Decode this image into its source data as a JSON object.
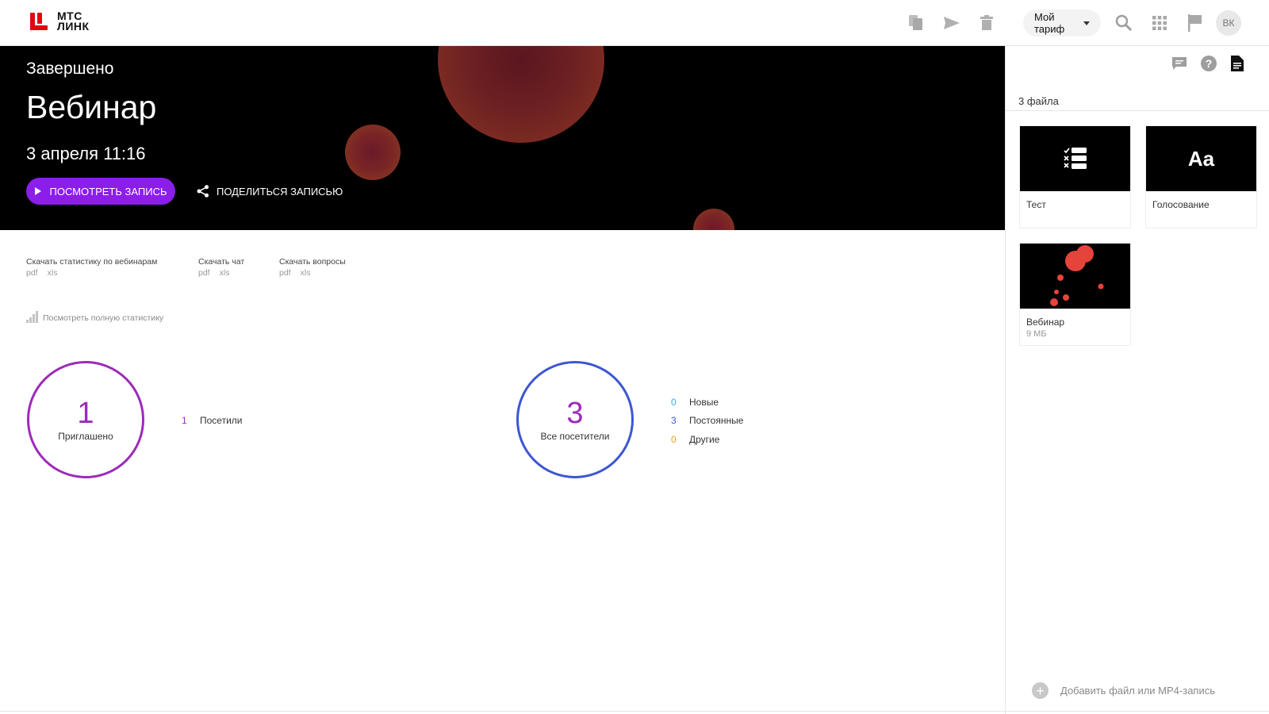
{
  "header": {
    "logo_line1": "МТС",
    "logo_line2": "ЛИНК",
    "tariff_label": "Мой тариф",
    "avatar_initials": "ВК"
  },
  "hero": {
    "status": "Завершено",
    "title": "Вебинар",
    "date": "3 апреля 11:16",
    "watch_button": "ПОСМОТРЕТЬ ЗАПИСЬ",
    "share_button": "ПОДЕЛИТЬСЯ ЗАПИСЬЮ"
  },
  "downloads": [
    {
      "label": "Скачать статистику по вебинарам",
      "formats": [
        "pdf",
        "xls"
      ]
    },
    {
      "label": "Скачать чат",
      "formats": [
        "pdf",
        "xls"
      ]
    },
    {
      "label": "Скачать вопросы",
      "formats": [
        "pdf",
        "xls"
      ]
    }
  ],
  "full_stats_link": "Посмотреть полную статистику",
  "invited": {
    "count": "1",
    "label": "Приглашено",
    "rows": [
      {
        "value": "1",
        "label": "Посетили",
        "color": "#9c2bb8"
      }
    ]
  },
  "visitors": {
    "count": "3",
    "label": "Все посетители",
    "rows": [
      {
        "value": "0",
        "label": "Новые",
        "color": "#3aa5e8"
      },
      {
        "value": "3",
        "label": "Постоянные",
        "color": "#3d56d1"
      },
      {
        "value": "0",
        "label": "Другие",
        "color": "#e0a030"
      }
    ]
  },
  "files": {
    "count_label": "3 файла",
    "items": [
      {
        "name": "Тест",
        "size": "",
        "thumb_icon": "test-icon"
      },
      {
        "name": "Голосование",
        "size": "",
        "thumb_text": "Aa"
      },
      {
        "name": "Вебинар",
        "size": "9 МБ",
        "thumb_icon": "webinar-thumb"
      }
    ],
    "add_label": "Добавить файл или MP4-запись"
  },
  "colors": {
    "accent": "#8b1ee8",
    "brand_red": "#e30611",
    "invited_ring": "#9c2bb8",
    "visitors_ring": "#3d56d1"
  }
}
